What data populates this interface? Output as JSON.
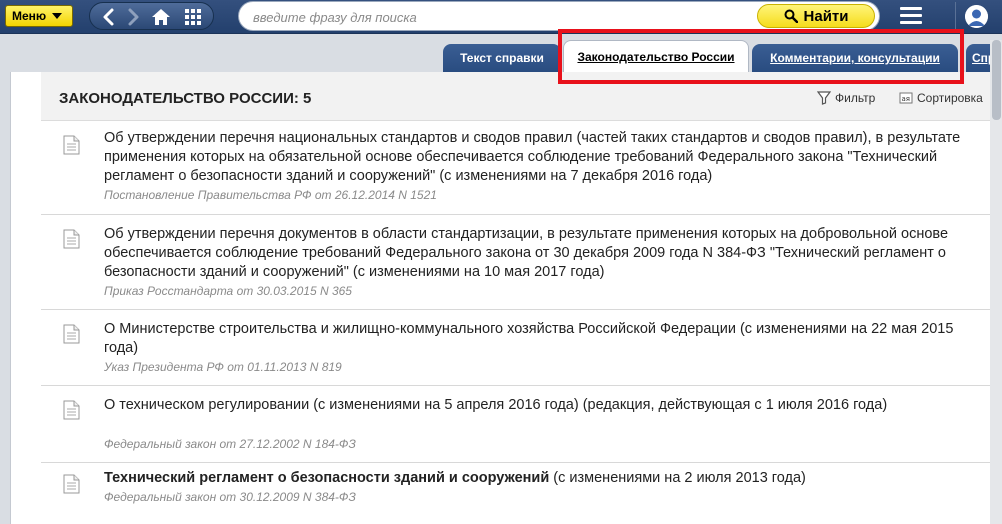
{
  "topbar": {
    "menu_label": "Меню",
    "search_placeholder": "введите фразу для поиска",
    "find_label": "Найти",
    "icons": [
      "back-icon",
      "forward-icon",
      "home-icon",
      "grid-icon",
      "search-icon",
      "hamburger-icon",
      "user-icon"
    ]
  },
  "tabs": [
    {
      "label": "Текст справки",
      "active": false
    },
    {
      "label": "Законодательство России",
      "active": true
    },
    {
      "label": "Комментарии, консультации",
      "active": false
    },
    {
      "label": "Спр",
      "active": false
    }
  ],
  "header": {
    "title": "ЗАКОНОДАТЕЛЬСТВО РОССИИ: 5",
    "filter_label": "Фильтр",
    "sort_label": "Сортировка"
  },
  "items": [
    {
      "title": "Об утверждении перечня национальных стандартов и сводов правил (частей таких стандартов и сводов правил), в результате применения которых на обязательной основе обеспечивается соблюдение требований Федерального закона \"Технический регламент о безопасности зданий и сооружений\" (с изменениями на 7 декабря 2016 года)",
      "source": "Постановление Правительства РФ от 26.12.2014 N 1521"
    },
    {
      "title": "Об утверждении перечня документов в области стандартизации, в результате применения которых на добровольной основе обеспечивается соблюдение требований Федерального закона от 30 декабря 2009 года N 384-ФЗ \"Технический регламент о безопасности зданий и сооружений\" (с изменениями на 10 мая 2017 года)",
      "source": "Приказ Росстандарта от 30.03.2015 N 365"
    },
    {
      "title": "О Министерстве строительства и жилищно-коммунального хозяйства Российской Федерации (с изменениями на 22 мая 2015 года)",
      "source": "Указ Президента РФ от 01.11.2013 N 819"
    },
    {
      "title": "О техническом регулировании (с изменениями на 5 апреля 2016 года) (редакция, действующая с 1 июля 2016 года)",
      "source": "Федеральный закон от 27.12.2002 N 184-ФЗ"
    },
    {
      "title_bold": "Технический регламент о безопасности зданий и сооружений",
      "title_rest": " (с изменениями на 2 июля 2013 года)",
      "source": "Федеральный закон от 30.12.2009 N 384-ФЗ"
    }
  ],
  "colors": {
    "topbar": "#2b4875",
    "accent_yellow": "#f5dc1c",
    "highlight_red": "#e8111b",
    "tab_blue": "#294c80"
  }
}
